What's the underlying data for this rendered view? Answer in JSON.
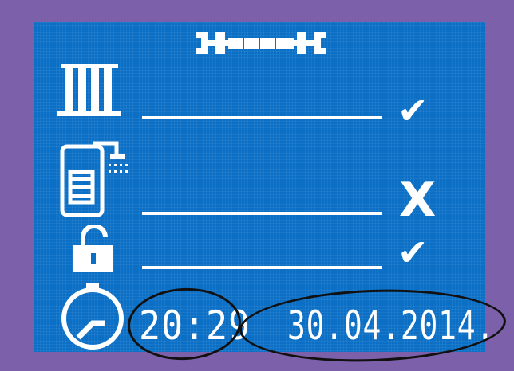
{
  "header": {
    "icon": "wrench-icon"
  },
  "rows": [
    {
      "name": "heating",
      "icon": "radiator-icon",
      "status": "enabled",
      "status_glyph": "✔"
    },
    {
      "name": "hot-water",
      "icon": "boiler-shower-icon",
      "status": "disabled",
      "status_glyph": "X"
    },
    {
      "name": "lock",
      "icon": "unlocked-padlock-icon",
      "status": "enabled",
      "status_glyph": "✔"
    }
  ],
  "footer": {
    "clock_icon": "clock-icon",
    "time": "20:29",
    "date": "30.04.2014."
  },
  "colors": {
    "screen": "#0b6fc6",
    "bezel": "#7c60a9",
    "foreground": "#ffffff",
    "annotation": "#111111"
  }
}
